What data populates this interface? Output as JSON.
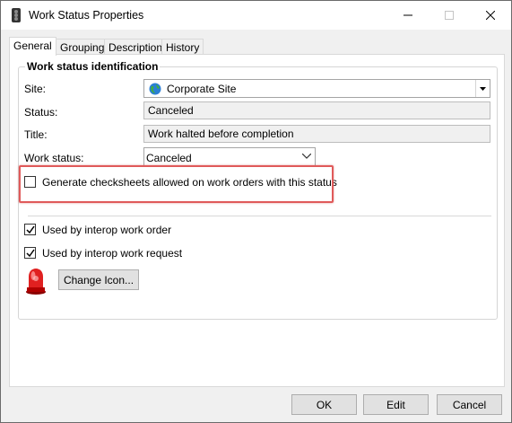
{
  "window": {
    "title": "Work Status Properties",
    "min_glyph": "—",
    "max_glyph": "☐",
    "close_glyph": "✕"
  },
  "tabs": [
    {
      "label": "General",
      "active": true
    },
    {
      "label": "Grouping",
      "active": false
    },
    {
      "label": "Description",
      "active": false
    },
    {
      "label": "History",
      "active": false
    }
  ],
  "group": {
    "title": "Work status identification"
  },
  "fields": {
    "site_label": "Site:",
    "site_value": "Corporate Site",
    "status_label": "Status:",
    "status_value": "Canceled",
    "title_label": "Title:",
    "title_value": "Work halted before completion",
    "work_status_label": "Work status:",
    "work_status_value": "Canceled"
  },
  "checkboxes": {
    "generate_checksheets": {
      "label": "Generate checksheets allowed on work orders with this status",
      "checked": false
    },
    "interop_work_order": {
      "label": "Used by interop work order",
      "checked": true
    },
    "interop_work_request": {
      "label": "Used by interop work request",
      "checked": true
    }
  },
  "buttons": {
    "change_icon": "Change Icon...",
    "ok": "OK",
    "edit": "Edit",
    "cancel": "Cancel"
  },
  "colors": {
    "highlight_box": "#e05a5a",
    "siren_red": "#e02020"
  },
  "icons": {
    "app": "traffic-light-icon",
    "site": "globe-icon",
    "status_icon": "red-siren-icon"
  }
}
